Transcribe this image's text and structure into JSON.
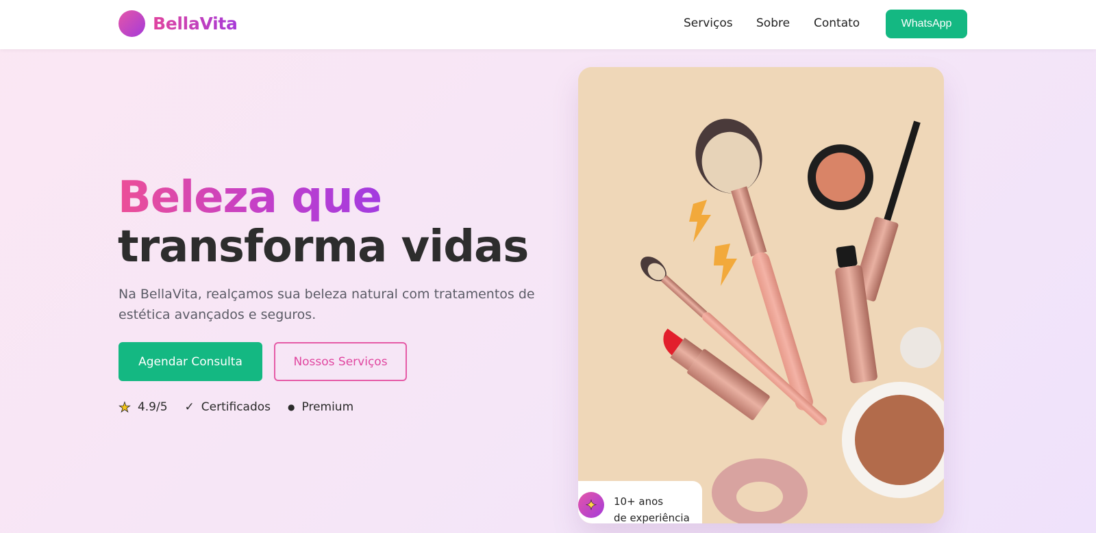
{
  "brand": {
    "name": "BellaVita"
  },
  "nav": {
    "items": [
      "Serviços",
      "Sobre",
      "Contato"
    ],
    "cta_label": "WhatsApp"
  },
  "hero": {
    "title_line1": "Beleza que",
    "title_line2": "transforma vidas",
    "description": "Na BellaVita, realçamos sua beleza natural com tratamentos de estética avançados e seguros.",
    "primary_button": "Agendar Consulta",
    "secondary_button": "Nossos Serviços",
    "badges": [
      {
        "icon": "star-icon",
        "label": "4.9/5"
      },
      {
        "icon": "check-icon",
        "label": "Certificados"
      },
      {
        "icon": "dot-icon",
        "label": "Premium"
      }
    ]
  },
  "experience_badge": {
    "icon": "sparkle-icon",
    "line1": "10+ anos",
    "line2": "de experiência"
  },
  "colors": {
    "accent_green": "#14b882",
    "brand_pink": "#e0459f",
    "brand_purple": "#a63ad8",
    "card_beige": "#efd7b8"
  }
}
